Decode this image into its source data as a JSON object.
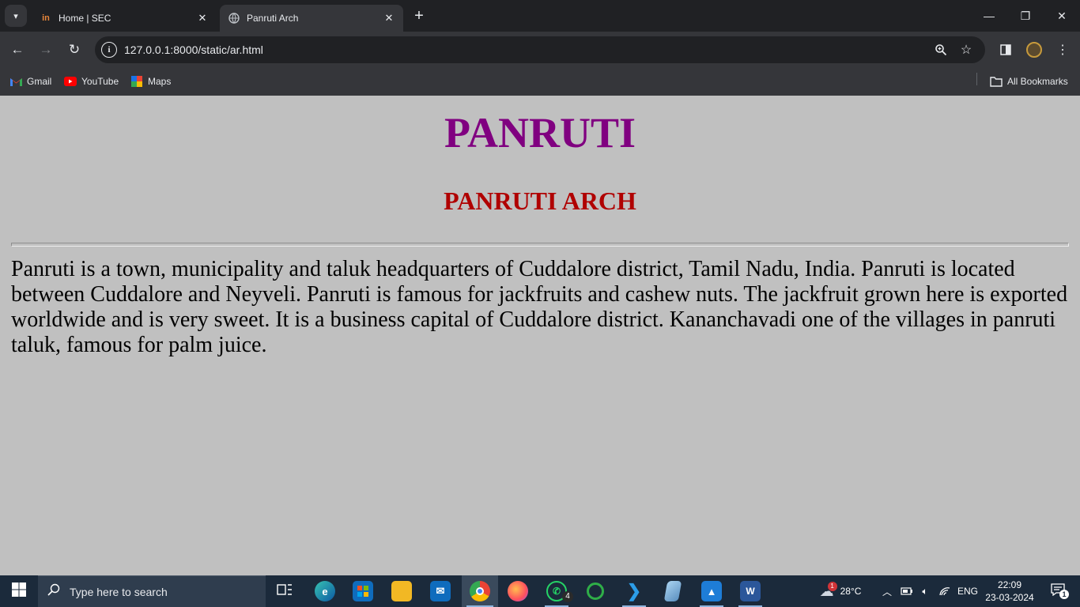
{
  "browser": {
    "tabs": [
      {
        "title": "Home | SEC",
        "favicon": "in-logo-icon",
        "active": false
      },
      {
        "title": "Panruti Arch",
        "favicon": "globe-icon",
        "active": true
      }
    ],
    "url": "127.0.0.1:8000/static/ar.html",
    "bookmarks": [
      {
        "label": "Gmail",
        "icon": "gmail-icon"
      },
      {
        "label": "YouTube",
        "icon": "youtube-icon"
      },
      {
        "label": "Maps",
        "icon": "maps-icon"
      }
    ],
    "all_bookmarks_label": "All Bookmarks"
  },
  "page": {
    "heading": "PANRUTI",
    "subheading": "PANRUTI ARCH",
    "paragraph": "Panruti is a town, municipality and taluk headquarters of Cuddalore district, Tamil Nadu, India. Panruti is located between Cuddalore and Neyveli. Panruti is famous for jackfruits and cashew nuts. The jackfruit grown here is exported worldwide and is very sweet. It is a business capital of Cuddalore district. Kananchavadi one of the villages in panruti taluk, famous for palm juice.",
    "colors": {
      "background": "#c0c0c0",
      "heading": "#800080",
      "subheading": "#b00000"
    }
  },
  "taskbar": {
    "search_placeholder": "Type here to search",
    "weather": "28°C",
    "weather_badge": "1",
    "language": "ENG",
    "time": "22:09",
    "date": "23-03-2024",
    "notification_count": "1",
    "whatsapp_badge": "4"
  }
}
